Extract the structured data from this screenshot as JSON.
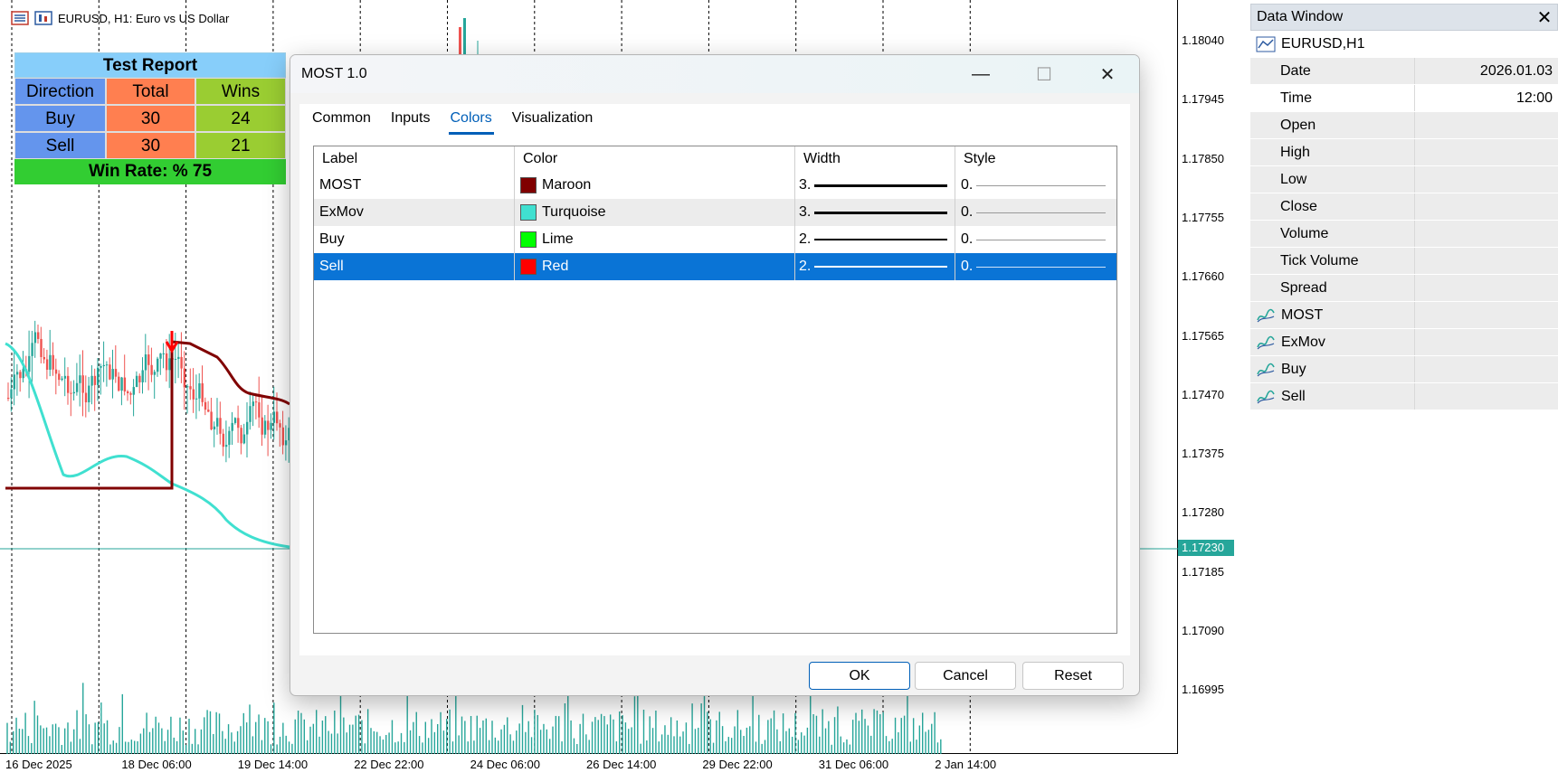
{
  "chart": {
    "title": "EURUSD, H1:  Euro vs US Dollar",
    "prices": [
      "1.18040",
      "1.17945",
      "1.17850",
      "1.17755",
      "1.17660",
      "1.17565",
      "1.17470",
      "1.17375",
      "1.17280",
      "1.17185",
      "1.17090",
      "1.16995"
    ],
    "current_price": "1.17230",
    "times": [
      "16 Dec 2025",
      "18 Dec 06:00",
      "19 Dec 14:00",
      "22 Dec 22:00",
      "24 Dec 06:00",
      "26 Dec 14:00",
      "29 Dec 22:00",
      "31 Dec 06:00",
      "2 Jan 14:00"
    ],
    "colors": {
      "bull": "#26a69a",
      "bear": "#ef5350",
      "most": "#800000",
      "exmov": "#40e0d0",
      "sell_arrow": "#ff0000"
    }
  },
  "test_report": {
    "title": "Test Report",
    "headers": [
      "Direction",
      "Total",
      "Wins"
    ],
    "rows": [
      {
        "direction": "Buy",
        "total": "30",
        "wins": "24"
      },
      {
        "direction": "Sell",
        "total": "30",
        "wins": "21"
      }
    ],
    "win_rate": "Win Rate: %  75"
  },
  "dialog": {
    "title": "MOST 1.0",
    "tabs": [
      "Common",
      "Inputs",
      "Colors",
      "Visualization"
    ],
    "active_tab": "Colors",
    "columns": [
      "Label",
      "Color",
      "Width",
      "Style"
    ],
    "rows": [
      {
        "label": "MOST",
        "color_name": "Maroon",
        "color": "#800000",
        "width": "3.",
        "style": "0."
      },
      {
        "label": "ExMov",
        "color_name": "Turquoise",
        "color": "#40e0d0",
        "width": "3.",
        "style": "0."
      },
      {
        "label": "Buy",
        "color_name": "Lime",
        "color": "#00ff00",
        "width": "2.",
        "style": "0."
      },
      {
        "label": "Sell",
        "color_name": "Red",
        "color": "#ff0000",
        "width": "2.",
        "style": "0."
      }
    ],
    "buttons": {
      "ok": "OK",
      "cancel": "Cancel",
      "reset": "Reset"
    }
  },
  "data_window": {
    "title": "Data Window",
    "symbol": "EURUSD,H1",
    "fields": [
      {
        "name": "Date",
        "value": "2026.01.03"
      },
      {
        "name": "Time",
        "value": "12:00"
      },
      {
        "name": "Open",
        "value": ""
      },
      {
        "name": "High",
        "value": ""
      },
      {
        "name": "Low",
        "value": ""
      },
      {
        "name": "Close",
        "value": ""
      },
      {
        "name": "Volume",
        "value": ""
      },
      {
        "name": "Tick Volume",
        "value": ""
      },
      {
        "name": "Spread",
        "value": ""
      }
    ],
    "indicators": [
      {
        "name": "MOST",
        "value": ""
      },
      {
        "name": "ExMov",
        "value": ""
      },
      {
        "name": "Buy",
        "value": ""
      },
      {
        "name": "Sell",
        "value": ""
      }
    ]
  }
}
